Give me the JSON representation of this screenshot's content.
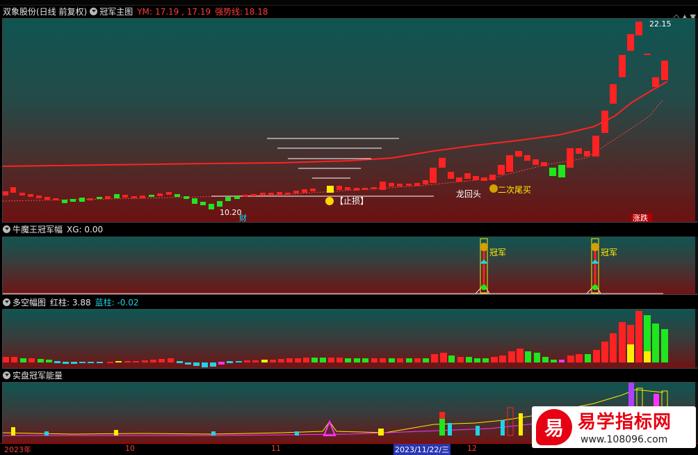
{
  "main_pane": {
    "title": "双象股份(日线 前复权)",
    "indicator": "冠军主图",
    "ym_label": "YM:",
    "ym_values": "17.19 , 17.19",
    "trend_label": "强势线:",
    "trend_value": "18.18",
    "high_label": "22.15",
    "low_label": "10.20",
    "annotation_stop": "【止损】",
    "annotation_dragon": "龙回头",
    "annotation_second": "二次尾买",
    "tag_cai": "财",
    "tag_zhangdie": "涨跌"
  },
  "pane2": {
    "title": "牛魔王冠军幅",
    "value_label": "XG: 0.00",
    "signal_label_1": "冠军",
    "signal_label_2": "冠军"
  },
  "pane3": {
    "title": "多空幅图",
    "red_label": "红柱: 3.88",
    "blue_label": "蓝柱: -0.02"
  },
  "pane4": {
    "title": "实盘冠军能量"
  },
  "timebar": {
    "labels": [
      "2023年",
      "10",
      "11",
      "2023/11/22/三",
      "12"
    ]
  },
  "watermark": {
    "icon_char": "易",
    "title": "易学指标网",
    "url": "www.108096.com"
  },
  "colors": {
    "up": "#ff1f1f",
    "down": "#1fe61f",
    "yellow": "#ffee00",
    "cyan": "#1fd3e6"
  }
}
